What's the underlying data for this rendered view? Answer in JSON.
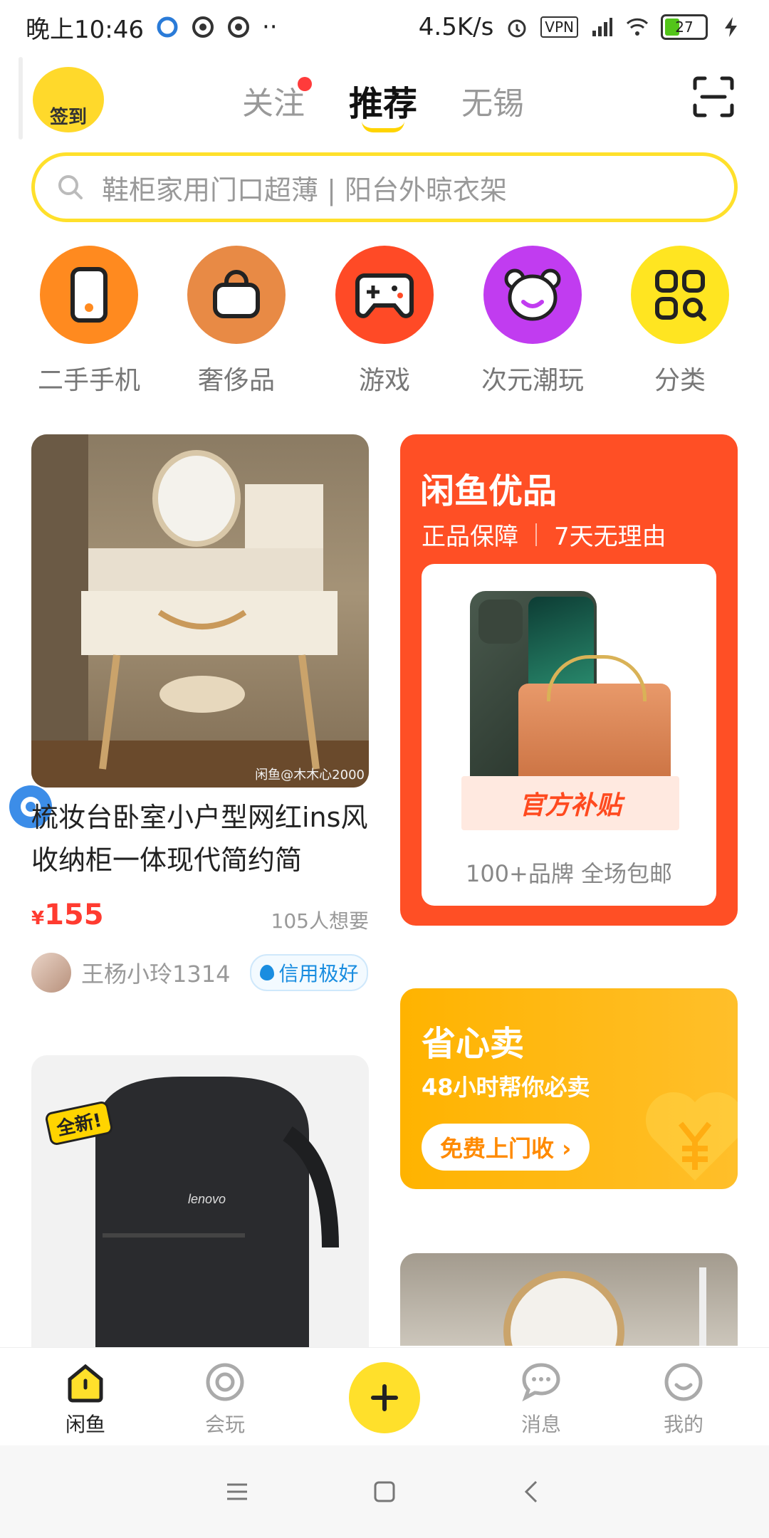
{
  "status_bar": {
    "time": "晚上10:46",
    "dots": "··",
    "net_speed": "4.5K/s",
    "vpn": "VPN",
    "battery": "27"
  },
  "header": {
    "checkin_label": "签到",
    "tabs": [
      {
        "label": "关注",
        "has_dot": true
      },
      {
        "label": "推荐",
        "active": true
      },
      {
        "label": "无锡"
      }
    ]
  },
  "search": {
    "placeholder": "鞋柜家用门口超薄 | 阳台外晾衣架"
  },
  "categories": [
    {
      "label": "二手手机",
      "icon": "phone-icon",
      "color": "#ff8a1f"
    },
    {
      "label": "奢侈品",
      "icon": "bag-icon",
      "color": "#e88a45"
    },
    {
      "label": "游戏",
      "icon": "gamepad-icon",
      "color": "#ff4a26"
    },
    {
      "label": "次元潮玩",
      "icon": "bear-icon",
      "color": "#c13cf0"
    },
    {
      "label": "分类",
      "icon": "grid-search-icon",
      "color": "#ffe521"
    }
  ],
  "feed": {
    "item1": {
      "watermark": "闲鱼@木木心2000",
      "title": "梳妆台卧室小户型网红ins风收纳柜一体现代简约简",
      "price_symbol": "¥",
      "price": "155",
      "want_count": "105人想要",
      "seller_name": "王杨小玲1314",
      "credit_label": "信用极好"
    },
    "youpin": {
      "title": "闲鱼优品",
      "badge1": "正品保障",
      "badge2": "7天无理由",
      "subsidy": "官方补贴",
      "brandline": "100+品牌 全场包邮"
    },
    "sell": {
      "title": "省心卖",
      "subtitle": "48小时帮你必卖",
      "button": "免费上门收 ›"
    },
    "item2": {
      "badge": "全新!"
    }
  },
  "bottom_nav": [
    {
      "label": "闲鱼",
      "active": true
    },
    {
      "label": "会玩"
    },
    {
      "label": "消息"
    },
    {
      "label": "我的"
    }
  ],
  "colors": {
    "accent_yellow": "#ffe02b",
    "price_red": "#ff3b30",
    "youpin_orange": "#ff4f25",
    "sell_orange": "#ffb300"
  }
}
